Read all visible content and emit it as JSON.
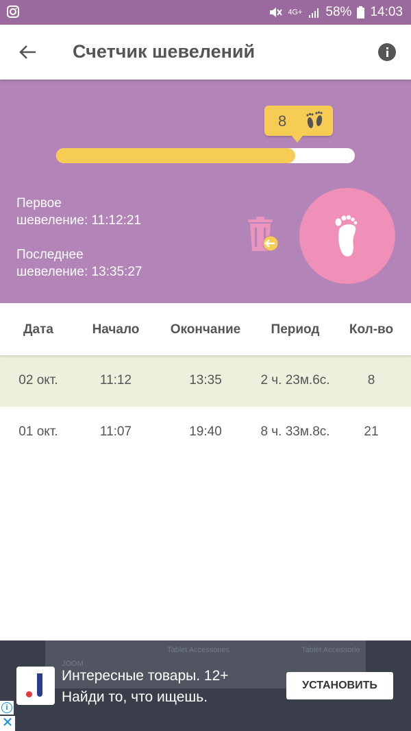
{
  "status_bar": {
    "battery": "58%",
    "time": "14:03",
    "network": "4G+"
  },
  "app_bar": {
    "title": "Счетчик шевелений"
  },
  "counter": {
    "count": "8",
    "progress_fraction": 0.8,
    "first_label": "Первое\nшевеление: 11:12:21",
    "last_label": "Последнее\nшевеление: 13:35:27"
  },
  "table": {
    "headers": [
      "Дата",
      "Начало",
      "Окончание",
      "Период",
      "Кол-во"
    ],
    "rows": [
      [
        "02 окт.",
        "11:12",
        "13:35",
        "2 ч. 23м.6с.",
        "8"
      ],
      [
        "01 окт.",
        "11:07",
        "19:40",
        "8 ч. 33м.8с.",
        "21"
      ]
    ]
  },
  "ad": {
    "line1": "Интересные товары. 12+",
    "line2": "Найди то, что ищешь.",
    "install": "УСТАНОВИТЬ",
    "bg_text_1": "Tablet Accessories",
    "bg_text_2": "Tablet Accessorie",
    "bg_text_3": "JOOM"
  },
  "colors": {
    "panel": "#b384b8",
    "accent": "#f7cc55",
    "tap_button": "#f08fb7",
    "selected_row": "#ecf0dc"
  }
}
